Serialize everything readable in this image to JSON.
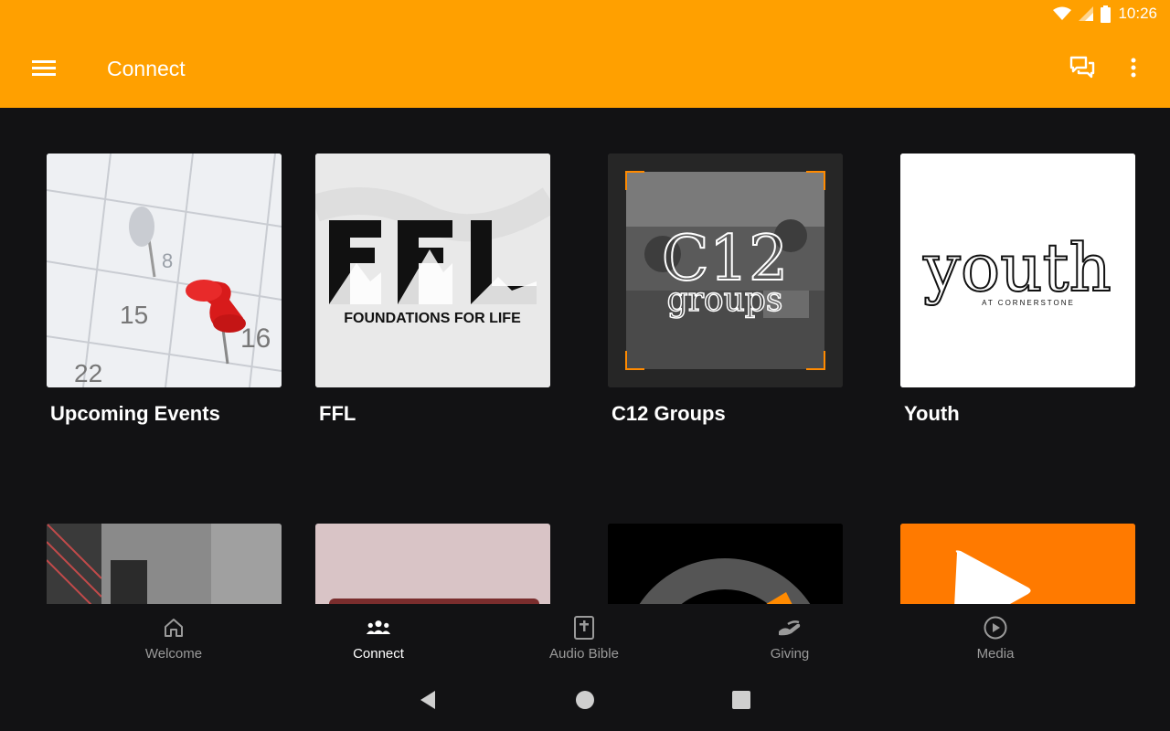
{
  "status_bar": {
    "time": "10:26",
    "icons": [
      "wifi-icon",
      "signal-icon",
      "battery-icon"
    ]
  },
  "app_bar": {
    "title": "Connect",
    "menu_icon": "hamburger-menu-icon",
    "chat_icon": "chat-icon",
    "more_icon": "more-vert-icon"
  },
  "cards": [
    {
      "label": "Upcoming Events",
      "image_text": [
        "15",
        "16",
        "22",
        "8"
      ]
    },
    {
      "label": "FFL",
      "image_text": [
        "FFL",
        "FOUNDATIONS FOR LIFE"
      ]
    },
    {
      "label": "C12 Groups",
      "image_text": [
        "C12",
        "groups"
      ]
    },
    {
      "label": "Youth",
      "image_text": [
        "youth",
        "AT CORNERSTONE"
      ]
    }
  ],
  "bottom_nav": [
    {
      "label": "Welcome",
      "icon": "home-icon",
      "active": false
    },
    {
      "label": "Connect",
      "icon": "people-icon",
      "active": true
    },
    {
      "label": "Audio Bible",
      "icon": "bible-icon",
      "active": false
    },
    {
      "label": "Giving",
      "icon": "giving-icon",
      "active": false
    },
    {
      "label": "Media",
      "icon": "play-circle-icon",
      "active": false
    }
  ],
  "colors": {
    "app_bar": "#FFA000",
    "background": "#121214",
    "accent_orange": "#FF7A00"
  }
}
